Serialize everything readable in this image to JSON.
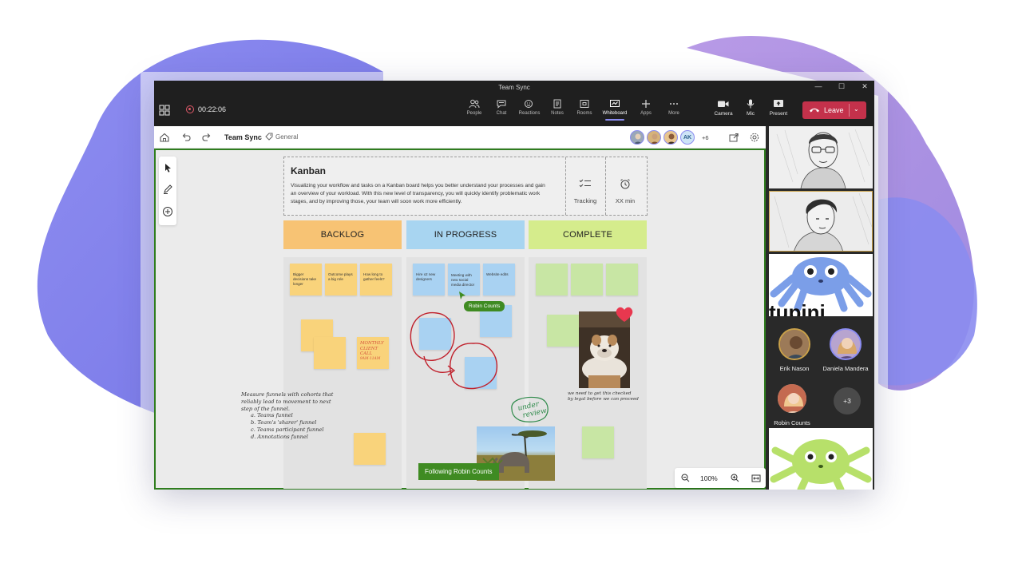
{
  "window": {
    "title": "Team Sync"
  },
  "meeting": {
    "timer": "00:22:06",
    "buttons": [
      "People",
      "Chat",
      "Reactions",
      "Notes",
      "Rooms",
      "Whiteboard",
      "Apps",
      "More"
    ],
    "active_button": "Whiteboard",
    "device_buttons": [
      "Camera",
      "Mic",
      "Present"
    ],
    "leave_label": "Leave",
    "accent": "#8b8cf0",
    "leave_color": "#c4314b"
  },
  "whiteboard": {
    "title": "Team Sync",
    "tag": "General",
    "participants_initials": "AK",
    "extra_count": "+6",
    "zoom": "100%",
    "following": "Following Robin Counts",
    "cursor_user": "Robin Counts"
  },
  "intro": {
    "title": "Kanban",
    "body": "Visualizing your workflow and tasks on a Kanban board helps you better understand your processes and gain an overview of your workload. With this new level of transparency, you will quickly identify problematic work stages, and by improving those, your team will soon work more efficiently.",
    "tools": [
      "Tracking",
      "XX min"
    ]
  },
  "columns": [
    {
      "title": "BACKLOG",
      "color": "#f7c374"
    },
    {
      "title": "IN PROGRESS",
      "color": "#a8d5f1"
    },
    {
      "title": "COMPLETE",
      "color": "#d5ec8c"
    }
  ],
  "stickies": {
    "backlog": [
      "Bigger decisions take longer",
      "Outcome plays a big role",
      "How long to gather feels?"
    ],
    "in_progress": [
      "Hire x2 new designers",
      "Meeting with new social media director",
      "Website edits"
    ],
    "handwritten_sticky": [
      "MONTHLY",
      "CLIENT",
      "CALL",
      "9AM-11AM"
    ],
    "under_review": [
      "under",
      "review"
    ]
  },
  "notes": {
    "funnel": [
      "Measure funnels with cohorts that",
      "reliably lead to movement to next",
      "step of the funnel.",
      "a. Teams funnel",
      "b. Team's 'sharer' funnel",
      "c. Teams participant funnel",
      "d. Annotations funnel"
    ],
    "dog_caption": [
      "we need to get this checked",
      "by legal before we can proceed"
    ]
  },
  "video": {
    "participants": [
      {
        "name": "Erik Nason"
      },
      {
        "name": "Daniela Mandera"
      },
      {
        "name": "Robin Counts"
      }
    ],
    "more_count": "+3",
    "tile_text": "tupini"
  }
}
